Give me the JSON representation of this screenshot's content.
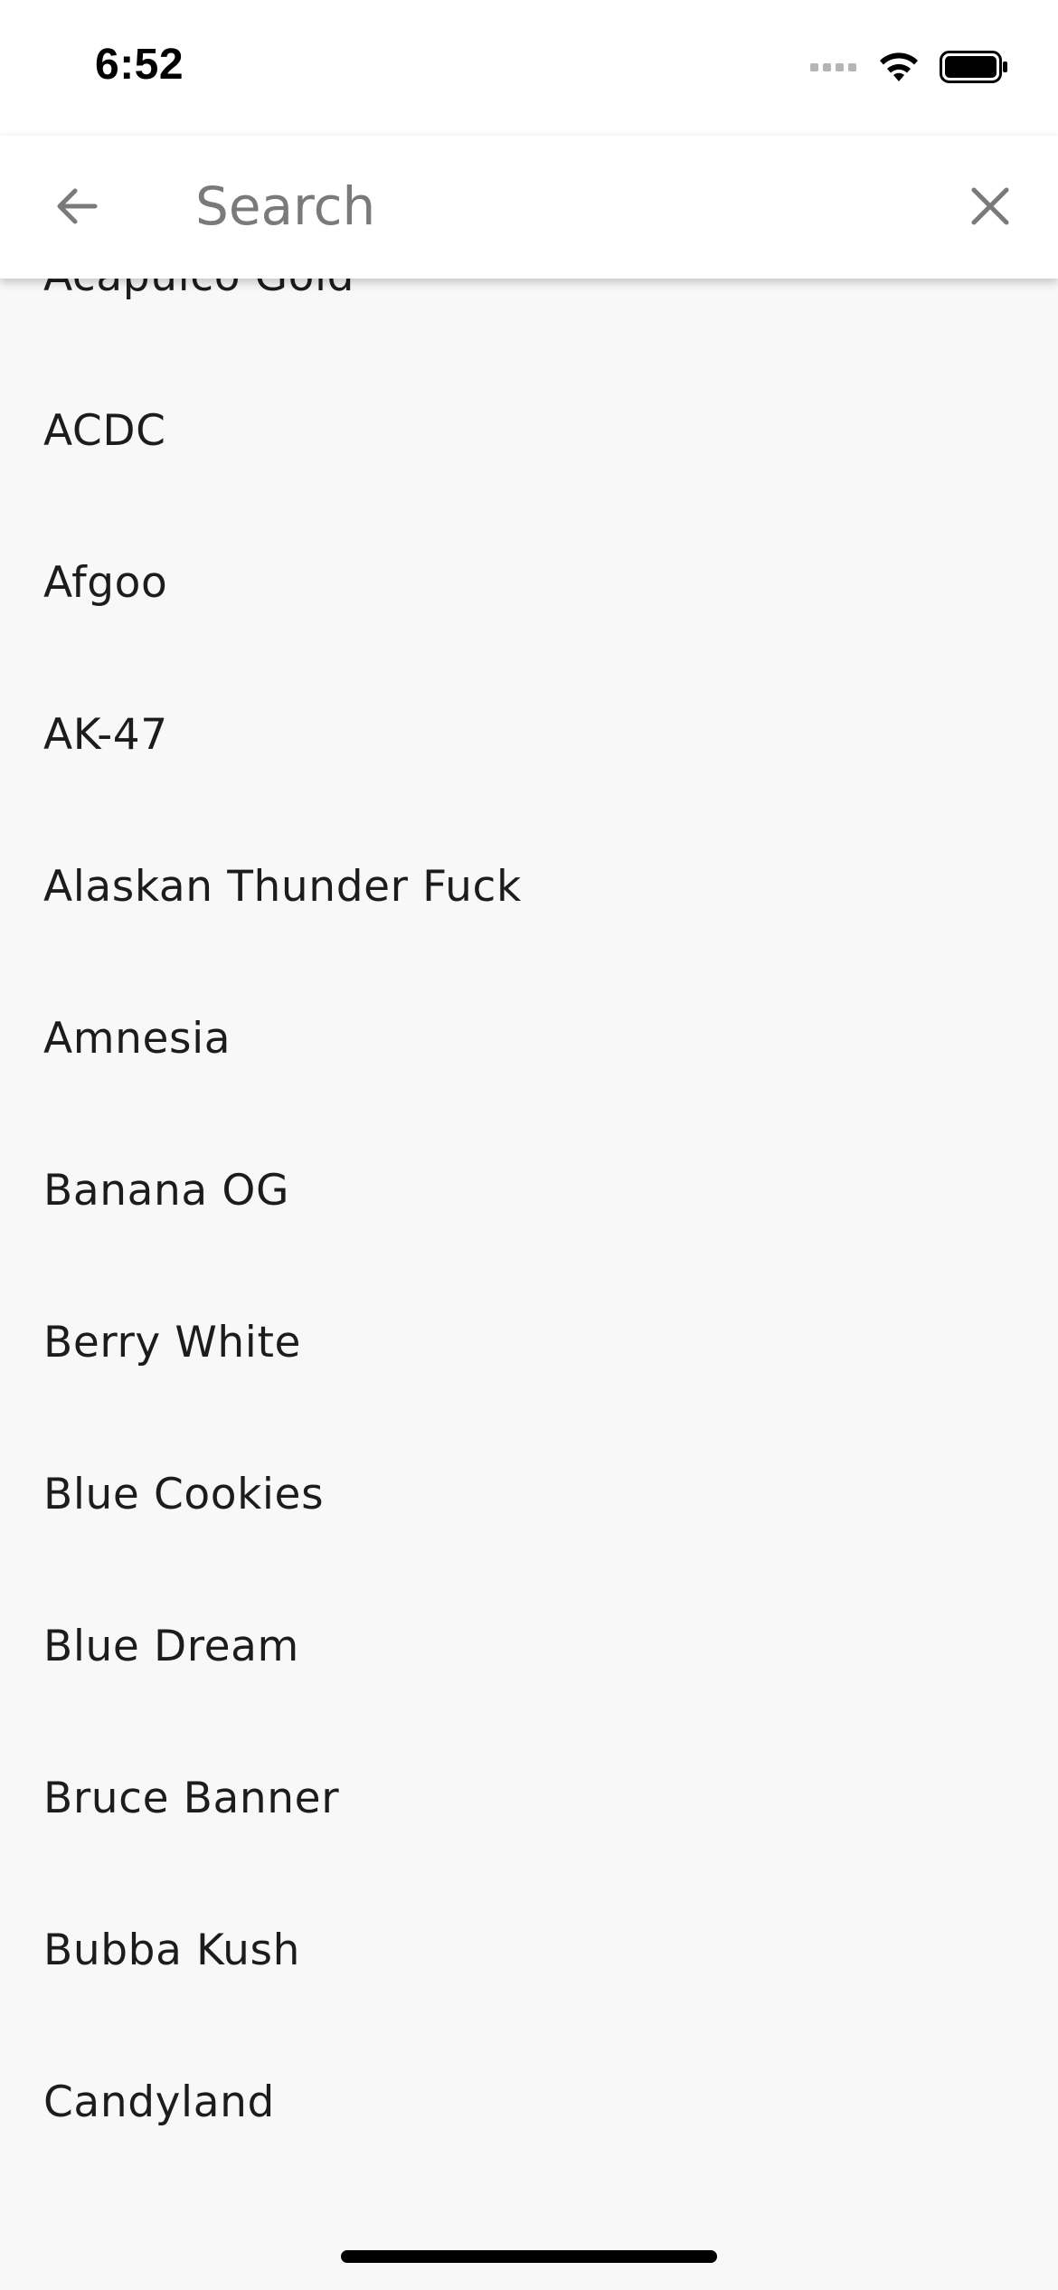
{
  "status_bar": {
    "time": "6:52"
  },
  "search": {
    "placeholder": "Search",
    "value": ""
  },
  "icons": {
    "back": "arrow-left-icon",
    "clear": "close-icon",
    "signal": "signal-icon",
    "wifi": "wifi-icon",
    "battery": "battery-icon"
  },
  "strains": [
    "Acapulco Gold",
    "ACDC",
    "Afgoo",
    "AK-47",
    "Alaskan Thunder Fuck",
    "Amnesia",
    "Banana OG",
    "Berry White",
    "Blue Cookies",
    "Blue Dream",
    "Bruce Banner",
    "Bubba Kush",
    "Candyland"
  ],
  "colors": {
    "background": "#f8f8f8",
    "header": "#ffffff",
    "text": "#1c1c1c",
    "icon": "#7a7a7a"
  }
}
